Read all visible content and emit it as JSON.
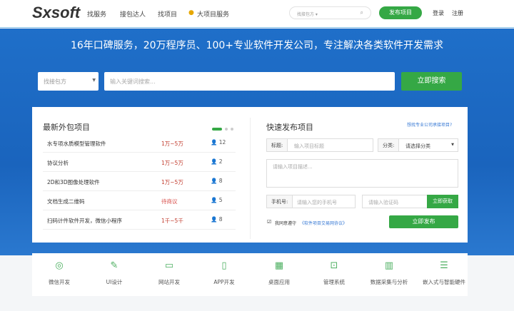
{
  "header": {
    "logo": "Sxsoft",
    "nav": [
      "找服务",
      "接包达人",
      "找项目",
      "大项目服务"
    ],
    "search_placeholder": "找接包方",
    "publish": "发布项目",
    "login": "登录",
    "register": "注册"
  },
  "hero": {
    "slogan": "16年口碑服务，20万程序员、100+专业软件开发公司，专注解决各类软件开发需求",
    "select": "找接包方",
    "keyword_placeholder": "输入关键词搜索...",
    "search_button": "立即搜索"
  },
  "projects": {
    "title": "最新外包项目",
    "items": [
      {
        "name": "水专项水质模型管理软件",
        "price": "1万~5万",
        "count": "12"
      },
      {
        "name": "协议分析",
        "price": "1万~5万",
        "count": "2"
      },
      {
        "name": "2D和3D图像处理软件",
        "price": "1万~5万",
        "count": "8"
      },
      {
        "name": "文档生成二维码",
        "price": "待商议",
        "count": "5"
      },
      {
        "name": "扫码计件软件开发，微信小程序",
        "price": "1千~5千",
        "count": "8"
      }
    ]
  },
  "quick": {
    "title": "快速发布项目",
    "link": "想找专业公司承接项目?",
    "title_label": "标题:",
    "title_placeholder": "输入项目标题",
    "category_label": "分类:",
    "category_value": "请选择分类",
    "desc_placeholder": "请输入项目描述...",
    "phone_label": "手机号:",
    "phone_placeholder": "请输入您的手机号",
    "code_placeholder": "请输入验证码",
    "get_code": "立即获取",
    "agree": "我同意遵守",
    "agreement": "《软件项目交易网协议》",
    "submit": "立即发布"
  },
  "categories": [
    {
      "label": "微信开发",
      "icon": "wechat-icon"
    },
    {
      "label": "UI设计",
      "icon": "design-icon"
    },
    {
      "label": "网站开发",
      "icon": "monitor-icon"
    },
    {
      "label": "APP开发",
      "icon": "phone-icon"
    },
    {
      "label": "桌面应用",
      "icon": "desktop-icon"
    },
    {
      "label": "管理系统",
      "icon": "chart-monitor-icon"
    },
    {
      "label": "数据采集与分析",
      "icon": "bar-chart-icon"
    },
    {
      "label": "嵌入式与智能硬件",
      "icon": "hardware-icon"
    }
  ],
  "colors": {
    "accent": "#35a845",
    "hero": "#1f6fc9"
  }
}
